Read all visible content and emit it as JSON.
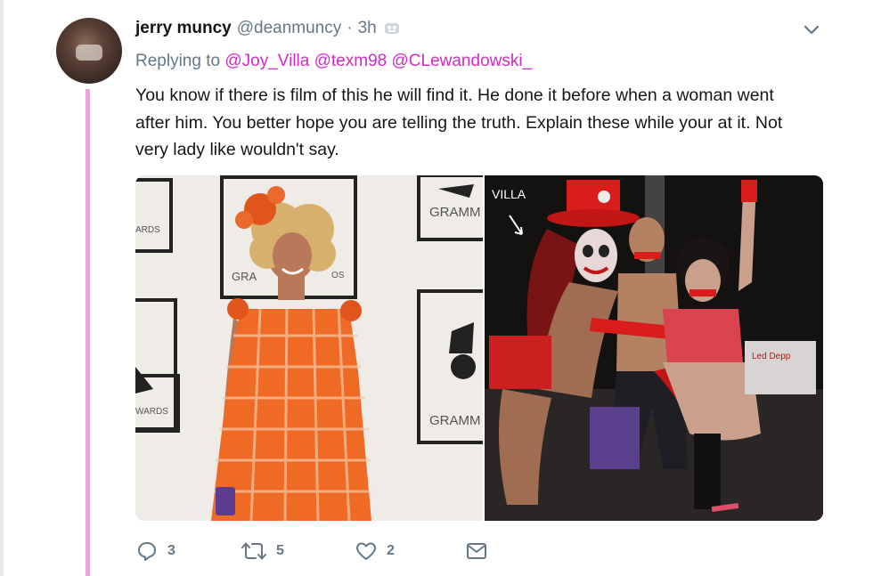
{
  "tweet": {
    "display_name": "jerry muncy",
    "handle": "@deanmuncy",
    "separator": "·",
    "time": "3h",
    "replying_prefix": "Replying to",
    "mentions": [
      "@Joy_Villa",
      "@texm98",
      "@CLewandowski_"
    ],
    "text": "You know if there is film of this he will find it. He done it before when a woman went after him. You better hope you are telling the truth. Explain these while your at it. Not very lady like wouldn't say."
  },
  "media": {
    "left_photo": {
      "backdrop_text": [
        "GRAMM",
        "ARDS",
        "GRA",
        "OS",
        "WARDS",
        "GRAMM"
      ]
    },
    "right_photo": {
      "overlay_text": "VILLA",
      "prop_text": "Led Depp"
    }
  },
  "actions": {
    "reply_count": "3",
    "retweet_count": "5",
    "like_count": "2"
  },
  "colors": {
    "thread_line": "#e9a8d9",
    "mention": "#d12ac7",
    "muted": "#657786"
  }
}
